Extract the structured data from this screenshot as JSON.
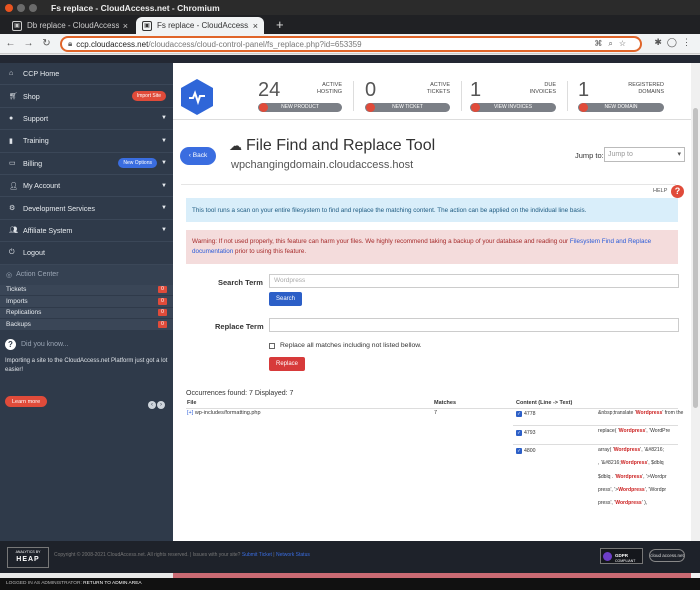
{
  "window": {
    "title": "Fs replace - CloudAccess.net - Chromium"
  },
  "tabs": [
    {
      "label": "Db replace - CloudAccess.n"
    },
    {
      "label": "Fs replace - CloudAccess.n"
    }
  ],
  "new_tab_symbol": "+",
  "address": {
    "host": "ccp.cloudaccess.net",
    "path": "/cloudaccess/cloud-control-panel/fs_replace.php?id=653359"
  },
  "sidebar": {
    "items": [
      {
        "label": "CCP Home",
        "icon": "home-icon"
      },
      {
        "label": "Shop",
        "icon": "cart-icon",
        "badge": "Import Site"
      },
      {
        "label": "Support",
        "icon": "chat-icon"
      },
      {
        "label": "Training",
        "icon": "book-icon"
      },
      {
        "label": "Billing",
        "icon": "card-icon",
        "badge": "New Options"
      },
      {
        "label": "My Account",
        "icon": "user-icon"
      },
      {
        "label": "Development Services",
        "icon": "gears-icon"
      },
      {
        "label": "Affiliate System",
        "icon": "users-icon"
      },
      {
        "label": "Logout",
        "icon": "logout-icon"
      }
    ],
    "action_center": {
      "title": "Action Center",
      "rows": [
        {
          "label": "Tickets",
          "count": "0"
        },
        {
          "label": "Imports",
          "count": "0"
        },
        {
          "label": "Replications",
          "count": "0"
        },
        {
          "label": "Backups",
          "count": "0"
        }
      ]
    },
    "did_you_know": {
      "title": "Did you know...",
      "text": "Importing a site to the CloudAccess.net Platform just got a lot easier!",
      "button": "Learn more"
    }
  },
  "stats": [
    {
      "number": "24",
      "label_line1": "ACTIVE",
      "label_line2": "HOSTING",
      "button": "NEW PRODUCT"
    },
    {
      "number": "0",
      "label_line1": "ACTIVE",
      "label_line2": "TICKETS",
      "button": "NEW TICKET"
    },
    {
      "number": "1",
      "label_line1": "DUE",
      "label_line2": "INVOICES",
      "button": "VIEW INVOICES"
    },
    {
      "number": "1",
      "label_line1": "REGISTERED",
      "label_line2": "DOMAINS",
      "button": "NEW DOMAIN"
    }
  ],
  "page": {
    "back_label": "Back",
    "title": "File Find and Replace Tool",
    "subtitle": "wpchangingdomain.cloudaccess.host",
    "jump_label": "Jump to:",
    "jump_placeholder": "Jump to",
    "help_label": "HELP",
    "info": "This tool runs a scan on your entire filesystem to find and replace the matching content. The action can be applied on the individual line basis.",
    "warning_text": "Warning: If not used properly, this feature can harm your files. We highly recommend taking a backup of your database and reading our ",
    "warning_link": "Filesystem Find and Replace documentation",
    "warning_tail": " prior to using this feature.",
    "search_label": "Search Term",
    "search_value": "Wordpress",
    "search_button": "Search",
    "replace_label": "Replace Term",
    "replace_value": "",
    "checkbox_label": "Replace all matches including not listed bellow.",
    "replace_button": "Replace"
  },
  "results": {
    "summary": "Occurrences found: 7 Displayed: 7",
    "headers": {
      "file": "File",
      "matches": "Matches",
      "content": "Content (Line -> Text)"
    },
    "file": "wp-includes/formatting.php",
    "file_prefix": "[+]",
    "matches": "7",
    "lines": [
      "4778",
      "4793",
      "4800"
    ],
    "texts": {
      "r1_a": "&nbsp;translate '",
      "r1_h": "Wordpress",
      "r1_b": "' from the",
      "r2_a": "replace( '",
      "r2_h": "Wordpress",
      "r2_b": "', 'WordPre",
      "r3_a": "array( '",
      "r3_h": "Wordpress",
      "r3_b": "', '&#8216;",
      "r4_a": ", '&#8216;",
      "r4_h": "Wordpress",
      "r4_b": "', $dblq",
      "r5_a": "$dblq . '",
      "r5_h": "Wordpress",
      "r5_b": "', '>Wordpr",
      "r6_a": "press', '>",
      "r6_h": "Wordpress",
      "r6_b": "', 'Wordpr",
      "r7_a": "press', '",
      "r7_h": "Wordpress",
      "r7_b": "' ),"
    }
  },
  "footer": {
    "heap_small": "ANALYTICS BY",
    "heap_big": "HEAP",
    "copyright": "Copyright © 2008-2021 CloudAccess.net. All rights reserved. | Issues with your site? ",
    "link1": "Submit Ticket",
    "sep": " | ",
    "link2": "Network Status",
    "gdpr_line1": "GDPR",
    "gdpr_line2": "COMPLIANT",
    "cloud_label": "cloud access.net",
    "logged_left": "LOGGED IN AS ADMINISTRATOR: ",
    "logged_right": "RETURN TO ADMIN AREA"
  },
  "colors": {
    "accent_red": "#e04b3a",
    "accent_blue": "#3a6de0",
    "sidebar_bg": "#2f3a4a",
    "omnibox_border": "#e0652a"
  }
}
